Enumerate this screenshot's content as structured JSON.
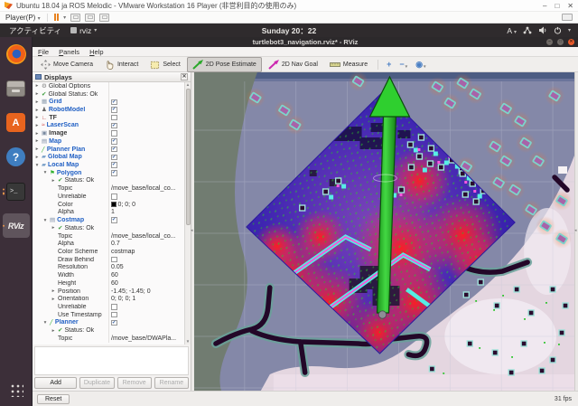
{
  "colors": {
    "accent_orange": "#e95420",
    "display_enabled_blue": "#2160c4",
    "status_ok_green": "#3d9e3d",
    "toolbar_active_bg": "#d5d2cf",
    "costmap_blue": "#2b17a6",
    "arrow_green": "#2fcf2f"
  },
  "vmware": {
    "title": "Ubuntu 18.04 ja ROS Melodic - VMware Workstation 16 Player (非営利目的の使用のみ)",
    "player_menu": "Player(P)",
    "window_controls": [
      "–",
      "□",
      "✕"
    ]
  },
  "ubuntu_bar": {
    "activities": "アクティビティ",
    "app_menu": "rviz",
    "clock": "Sunday 20：22",
    "input_indicator": "A"
  },
  "dock": {
    "items": [
      {
        "id": "firefox",
        "running": false,
        "active": false
      },
      {
        "id": "files",
        "running": false,
        "active": false
      },
      {
        "id": "software",
        "text": "A",
        "running": false,
        "active": false
      },
      {
        "id": "help",
        "text": "?",
        "running": false,
        "active": false
      },
      {
        "id": "terminal",
        "text": ">_",
        "running": true,
        "active": false
      },
      {
        "id": "rviz",
        "text": "RViz",
        "running": true,
        "active": true
      }
    ],
    "show_apps_id": "apps"
  },
  "rviz": {
    "titlebar": {
      "title": "turtlebot3_navigation.rviz* - RViz",
      "window_controls": [
        "–",
        "□",
        "✕"
      ]
    },
    "menus": [
      "File",
      "Panels",
      "Help"
    ],
    "toolbar": {
      "tools": [
        {
          "id": "move-camera",
          "label": "Move Camera",
          "active": false
        },
        {
          "id": "interact",
          "label": "Interact",
          "active": false
        },
        {
          "id": "select",
          "label": "Select",
          "active": false
        },
        {
          "id": "pose-estimate",
          "label": "2D Pose Estimate",
          "active": true
        },
        {
          "id": "nav-goal",
          "label": "2D Nav Goal",
          "active": false
        },
        {
          "id": "measure",
          "label": "Measure",
          "active": false
        }
      ],
      "extras": [
        {
          "id": "add-tool",
          "glyph": "+",
          "caret": false
        },
        {
          "id": "remove-tool",
          "glyph": "−",
          "caret": true
        },
        {
          "id": "focus-camera",
          "glyph": "◉",
          "caret": true
        }
      ]
    },
    "displays": {
      "title": "Displays",
      "rows": [
        {
          "indent": 0,
          "expander": "closed",
          "icon": "gear",
          "label": "Global Options",
          "kind": "root"
        },
        {
          "indent": 0,
          "expander": "closed",
          "icon": "check",
          "label": "Global Status: Ok",
          "kind": "status"
        },
        {
          "indent": 0,
          "expander": "closed",
          "icon": "grid",
          "label": "Grid",
          "kind": "display-on",
          "check": true
        },
        {
          "indent": 0,
          "expander": "closed",
          "icon": "robot",
          "label": "RobotModel",
          "kind": "display-on",
          "check": true
        },
        {
          "indent": 0,
          "expander": "closed",
          "icon": "tf",
          "label": "TF",
          "kind": "display-off",
          "check": false
        },
        {
          "indent": 0,
          "expander": "closed",
          "icon": "laser",
          "label": "LaserScan",
          "kind": "display-on",
          "check": true
        },
        {
          "indent": 0,
          "expander": "closed",
          "icon": "image",
          "label": "Image",
          "kind": "display-off",
          "check": false
        },
        {
          "indent": 0,
          "expander": "closed",
          "icon": "map",
          "label": "Map",
          "kind": "display-on",
          "check": true
        },
        {
          "indent": 0,
          "expander": "closed",
          "icon": "path",
          "label": "Planner Plan",
          "kind": "display-on",
          "check": true
        },
        {
          "indent": 0,
          "expander": "closed",
          "icon": "folder",
          "label": "Global Map",
          "kind": "display-on",
          "check": true
        },
        {
          "indent": 0,
          "expander": "open",
          "icon": "folder",
          "label": "Local Map",
          "kind": "display-on",
          "check": true
        },
        {
          "indent": 1,
          "expander": "open",
          "icon": "polygon",
          "label": "Polygon",
          "kind": "display-on",
          "check": true
        },
        {
          "indent": 2,
          "expander": "closed",
          "icon": "check",
          "label": "Status: Ok",
          "kind": "status"
        },
        {
          "indent": 2,
          "label": "Topic",
          "kind": "prop",
          "value": "/move_base/local_co..."
        },
        {
          "indent": 2,
          "label": "Unreliable",
          "kind": "prop",
          "check": false
        },
        {
          "indent": 2,
          "label": "Color",
          "kind": "prop",
          "value": "0; 0; 0",
          "swatch": true
        },
        {
          "indent": 2,
          "label": "Alpha",
          "kind": "prop",
          "value": "1"
        },
        {
          "indent": 1,
          "expander": "open",
          "icon": "map",
          "label": "Costmap",
          "kind": "display-on",
          "check": true
        },
        {
          "indent": 2,
          "expander": "closed",
          "icon": "check",
          "label": "Status: Ok",
          "kind": "status"
        },
        {
          "indent": 2,
          "label": "Topic",
          "kind": "prop",
          "value": "/move_base/local_co..."
        },
        {
          "indent": 2,
          "label": "Alpha",
          "kind": "prop",
          "value": "0.7"
        },
        {
          "indent": 2,
          "label": "Color Scheme",
          "kind": "prop",
          "value": "costmap"
        },
        {
          "indent": 2,
          "label": "Draw Behind",
          "kind": "prop",
          "check": false
        },
        {
          "indent": 2,
          "label": "Resolution",
          "kind": "prop",
          "value": "0.05"
        },
        {
          "indent": 2,
          "label": "Width",
          "kind": "prop",
          "value": "60"
        },
        {
          "indent": 2,
          "label": "Height",
          "kind": "prop",
          "value": "60"
        },
        {
          "indent": 2,
          "expander": "closed",
          "label": "Position",
          "kind": "prop",
          "value": "-1.45; -1.45; 0"
        },
        {
          "indent": 2,
          "expander": "closed",
          "label": "Orientation",
          "kind": "prop",
          "value": "0; 0; 0; 1"
        },
        {
          "indent": 2,
          "label": "Unreliable",
          "kind": "prop",
          "check": false
        },
        {
          "indent": 2,
          "label": "Use Timestamp",
          "kind": "prop",
          "check": false
        },
        {
          "indent": 1,
          "expander": "open",
          "icon": "path",
          "label": "Planner",
          "kind": "display-on",
          "check": true
        },
        {
          "indent": 2,
          "expander": "closed",
          "icon": "check",
          "label": "Status: Ok",
          "kind": "status"
        },
        {
          "indent": 2,
          "label": "Topic",
          "kind": "prop",
          "value": "/move_base/DWAPla..."
        }
      ],
      "buttons": [
        {
          "label": "Add",
          "enabled": true
        },
        {
          "label": "Duplicate",
          "enabled": false
        },
        {
          "label": "Remove",
          "enabled": false
        },
        {
          "label": "Rename",
          "enabled": false
        }
      ]
    },
    "statusbar": {
      "reset": "Reset",
      "fps": "31 fps"
    }
  }
}
